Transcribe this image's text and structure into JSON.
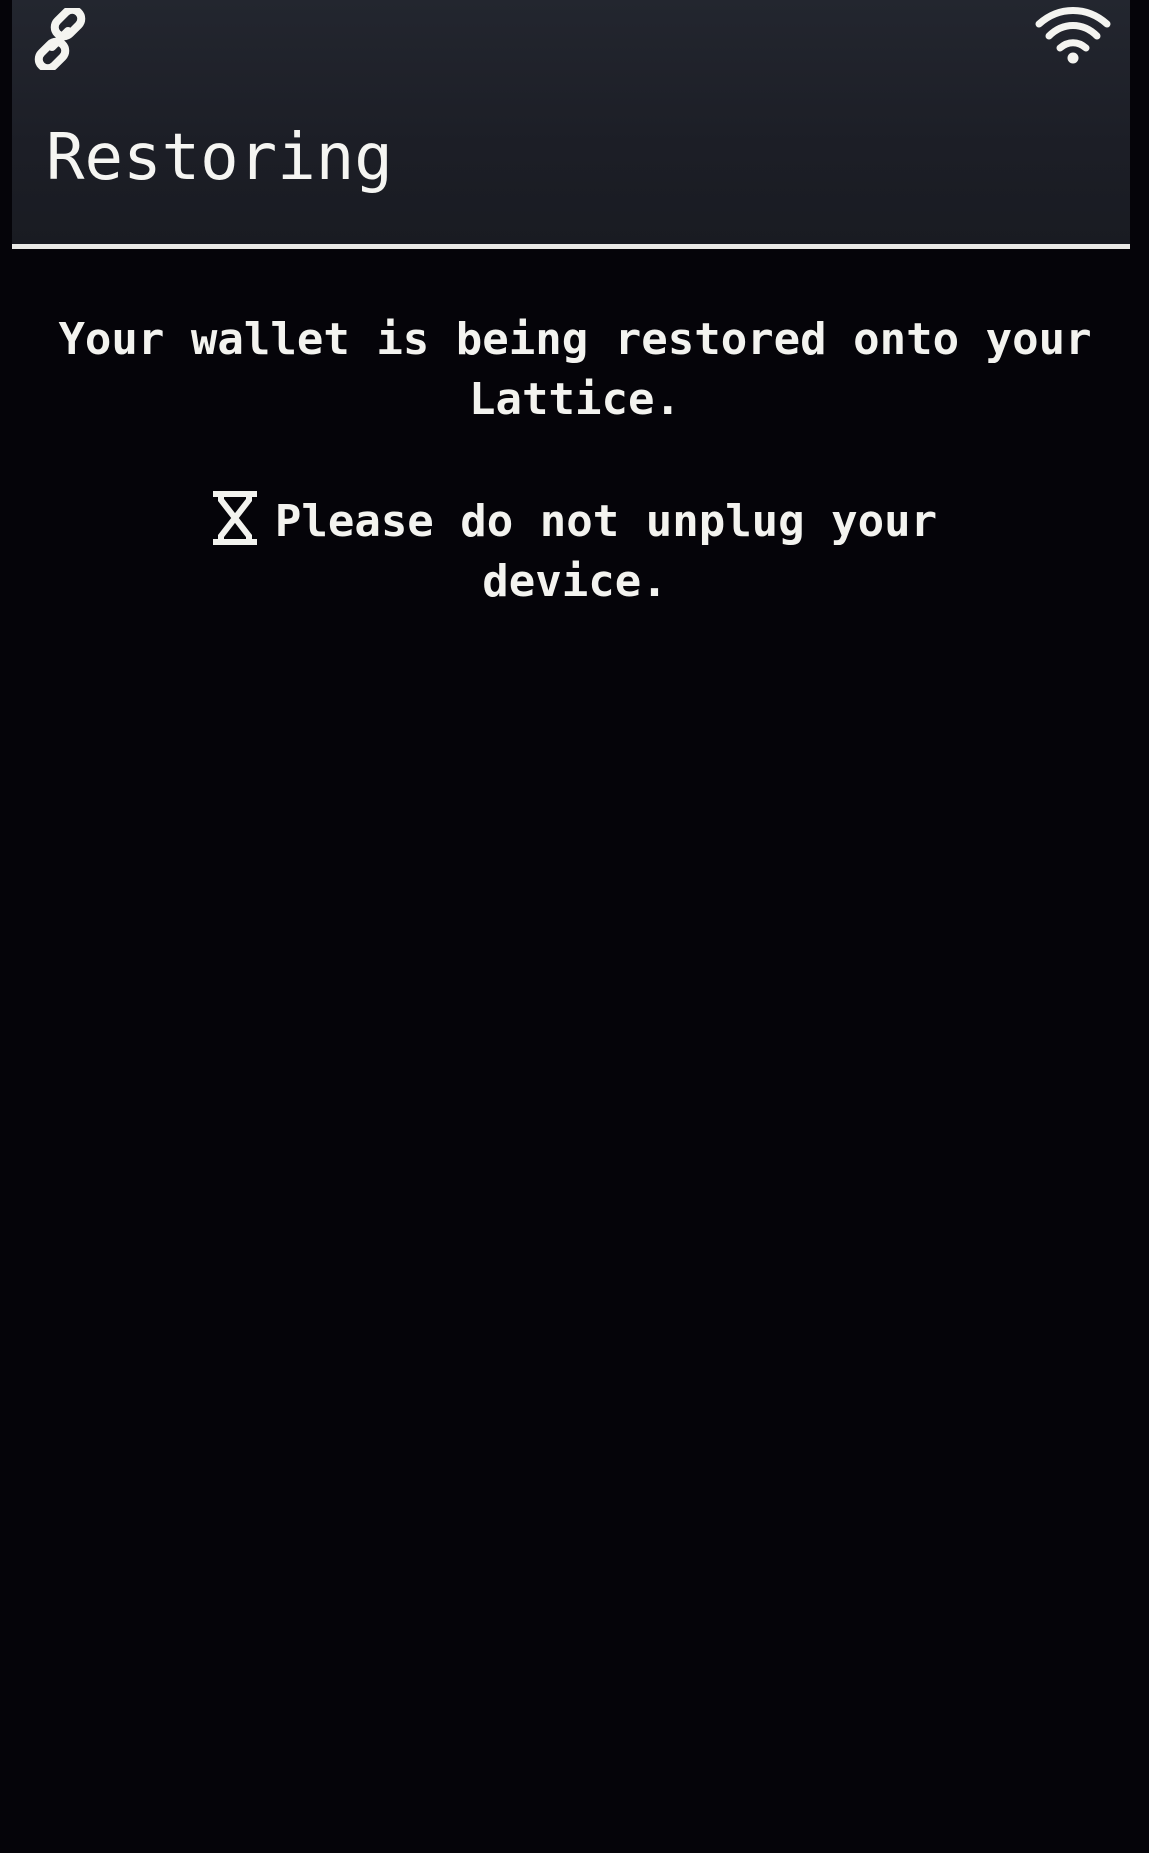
{
  "status_bar": {
    "left_icon": "link-icon",
    "right_icon": "wifi-icon"
  },
  "header": {
    "title": "Restoring"
  },
  "content": {
    "message": "Your wallet is being restored onto your Lattice.",
    "warning_icon": "hourglass-icon",
    "warning": "Please do not unplug your device."
  },
  "colors": {
    "background": "#050409",
    "header_background": "#1f2129",
    "text": "#f3f3ef",
    "divider": "#e9e9e6"
  }
}
